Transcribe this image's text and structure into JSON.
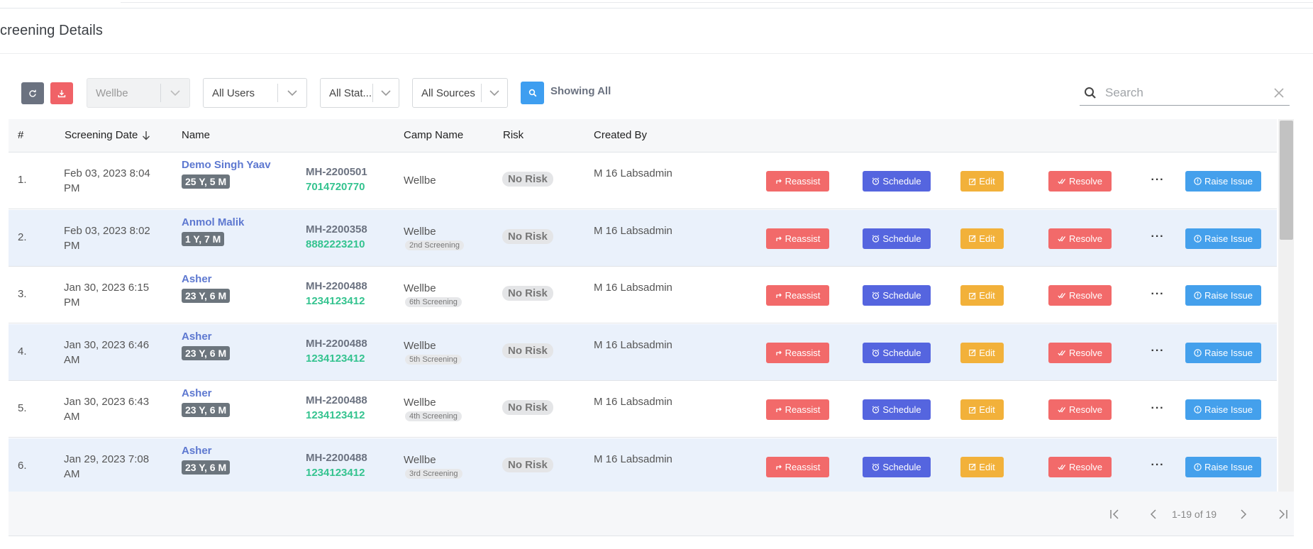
{
  "page": {
    "title": "creening Details"
  },
  "toolbar": {
    "refresh_icon": "refresh-icon",
    "download_icon": "download-icon",
    "filters": {
      "org": "Wellbe",
      "users": "All Users",
      "status": "All Stat...",
      "sources": "All Sources"
    },
    "showing_all": "Showing All"
  },
  "search": {
    "placeholder": "Search",
    "value": ""
  },
  "table": {
    "headers": {
      "index": "#",
      "date": "Screening Date",
      "name": "Name",
      "camp": "Camp Name",
      "risk": "Risk",
      "created_by": "Created By"
    },
    "actions": {
      "reassist": "Reassist",
      "schedule": "Schedule",
      "edit": "Edit",
      "resolve": "Resolve",
      "more": "···",
      "raise": "Raise Issue"
    },
    "rows": [
      {
        "idx": "1.",
        "date": "Feb 03, 2023 8:04 PM",
        "name": "Demo Singh Yaav",
        "age": "25 Y, 5 M",
        "mh": "MH-2200501",
        "phone": "7014720770",
        "camp": "Wellbe",
        "tag": "",
        "risk": "No Risk",
        "created_by": "M 16 Labsadmin"
      },
      {
        "idx": "2.",
        "date": "Feb 03, 2023 8:02 PM",
        "name": "Anmol Malik",
        "age": "1 Y, 7 M",
        "mh": "MH-2200358",
        "phone": "8882223210",
        "camp": "Wellbe",
        "tag": "2nd Screening",
        "risk": "No Risk",
        "created_by": "M 16 Labsadmin"
      },
      {
        "idx": "3.",
        "date": "Jan 30, 2023 6:15 PM",
        "name": "Asher",
        "age": "23 Y, 6 M",
        "mh": "MH-2200488",
        "phone": "1234123412",
        "camp": "Wellbe",
        "tag": "6th Screening",
        "risk": "No Risk",
        "created_by": "M 16 Labsadmin"
      },
      {
        "idx": "4.",
        "date": "Jan 30, 2023 6:46 AM",
        "name": "Asher",
        "age": "23 Y, 6 M",
        "mh": "MH-2200488",
        "phone": "1234123412",
        "camp": "Wellbe",
        "tag": "5th Screening",
        "risk": "No Risk",
        "created_by": "M 16 Labsadmin"
      },
      {
        "idx": "5.",
        "date": "Jan 30, 2023 6:43 AM",
        "name": "Asher",
        "age": "23 Y, 6 M",
        "mh": "MH-2200488",
        "phone": "1234123412",
        "camp": "Wellbe",
        "tag": "4th Screening",
        "risk": "No Risk",
        "created_by": "M 16 Labsadmin"
      },
      {
        "idx": "6.",
        "date": "Jan 29, 2023 7:08 AM",
        "name": "Asher",
        "age": "23 Y, 6 M",
        "mh": "MH-2200488",
        "phone": "1234123412",
        "camp": "Wellbe",
        "tag": "3rd Screening",
        "risk": "No Risk",
        "created_by": "M 16 Labsadmin"
      }
    ]
  },
  "pagination": {
    "range": "1-19 of 19"
  },
  "colors": {
    "reassist": "#f26a6a",
    "schedule": "#5565df",
    "edit": "#f2b13a",
    "resolve": "#f26a6a",
    "raise": "#44a0ec",
    "link": "#5d78d0",
    "phone": "#34c38f"
  }
}
